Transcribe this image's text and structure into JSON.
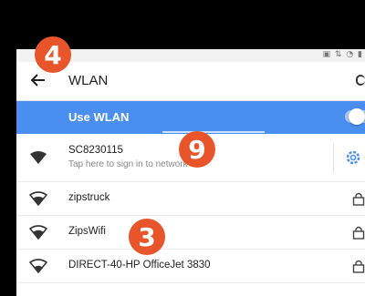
{
  "appbar": {
    "title": "WLAN"
  },
  "wlan_toggle": {
    "label": "Use WLAN",
    "state": "on"
  },
  "networks": [
    {
      "ssid": "SC8230115",
      "subtitle": "Tap here to sign in to network",
      "secured": false,
      "icon": "wifi-icon"
    },
    {
      "ssid": "zipstruck",
      "secured": true,
      "icon": "wifi-icon"
    },
    {
      "ssid": "ZipsWifi",
      "secured": true,
      "icon": "wifi-icon"
    },
    {
      "ssid": "DIRECT-40-HP OfficeJet 3830",
      "secured": true,
      "icon": "wifi-icon"
    }
  ],
  "badges": [
    "4",
    "9",
    "3"
  ],
  "colors": {
    "accent": "#4a8ff0",
    "badge": "#e8552a"
  }
}
